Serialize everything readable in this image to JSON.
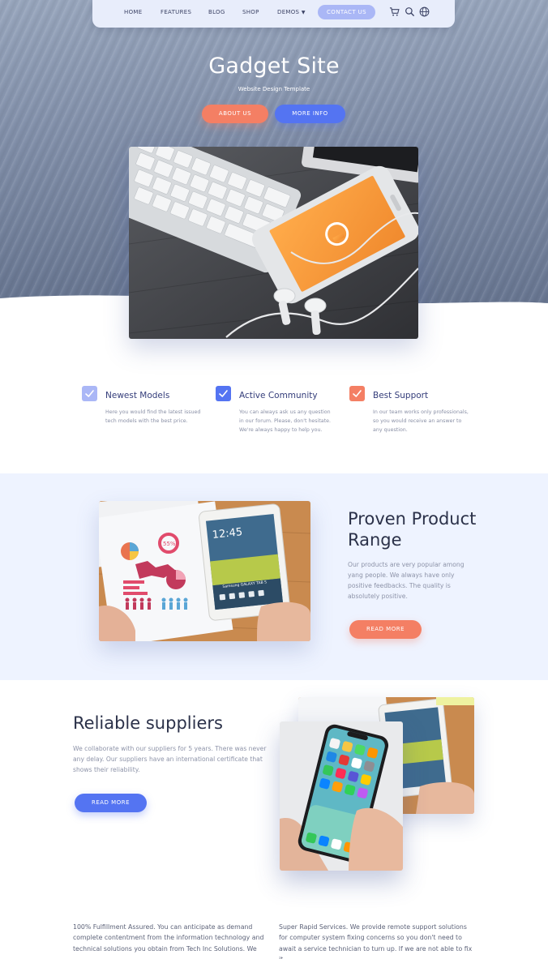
{
  "nav": {
    "items": [
      "HOME",
      "FEATURES",
      "BLOG",
      "SHOP",
      "DEMOS"
    ],
    "contact_label": "CONTACT US",
    "icons": [
      "cart-icon",
      "search-icon",
      "globe-icon"
    ]
  },
  "hero": {
    "title": "Gadget Site",
    "subtitle": "Website Design Template",
    "about_label": "ABOUT US",
    "more_label": "MORE INFO"
  },
  "features": [
    {
      "title": "Newest Models",
      "text": "Here you would find the latest issued tech models with the best price.",
      "color": "#aab7f6"
    },
    {
      "title": "Active Community",
      "text": "You can always ask us any question in our forum. Please, don't hesitate. We're always happy to help you.",
      "color": "#5474f2"
    },
    {
      "title": "Best Support",
      "text": "In our team works only professionals, so you would receive an answer to any question.",
      "color": "#f47f64"
    }
  ],
  "proven": {
    "title": "Proven Product Range",
    "text": "Our products are very popular among yang people. We always have only positive feedbacks. The quality is absolutely positive.",
    "button_label": "READ MORE"
  },
  "reliable": {
    "title": "Reliable suppliers",
    "text": "We collaborate with our suppliers for 5 years. There was never any delay. Our suppliers have an international certificate that shows their reliability.",
    "button_label": "READ MORE"
  },
  "bottom": {
    "left": "100% Fulfillment Assured. You can anticipate as demand complete contentment from the information technology and technical solutions you obtain from Tech Inc Solutions. We",
    "right": "Super Rapid Services. We provide remote support solutions for computer system fixing concerns so you don't need to await a service technician to turn up. If we are not able to fix it"
  },
  "image_text": {
    "tablet_time": "12:45",
    "tablet_brand": "Samsung GALAXY TAB S",
    "chart_percent": "55%"
  },
  "colors": {
    "accent_blue": "#5474f2",
    "accent_orange": "#f47f64",
    "light_blue": "#aab7f6",
    "section_bg": "#eef3ff"
  }
}
